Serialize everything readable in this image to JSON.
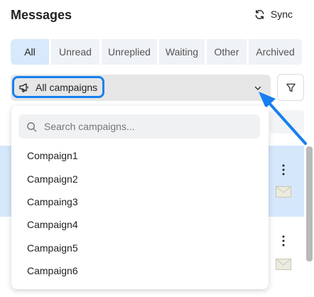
{
  "header": {
    "title": "Messages",
    "sync_label": "Sync",
    "sync_icon": "refresh-icon"
  },
  "tabs": [
    {
      "label": "All",
      "active": true
    },
    {
      "label": "Unread"
    },
    {
      "label": "Unreplied"
    },
    {
      "label": "Waiting"
    },
    {
      "label": "Other"
    },
    {
      "label": "Archived"
    }
  ],
  "campaign_select": {
    "selected": "All campaigns",
    "icon": "megaphone-icon"
  },
  "filter_icon": "filter-icon",
  "dropdown": {
    "search_placeholder": "Search campaigns...",
    "options": [
      "Compaign1",
      "Campaign2",
      "Campaing3",
      "Campaign4",
      "Campaign5",
      "Campaign6"
    ]
  },
  "colors": {
    "accent": "#1680f0",
    "active_tab": "#d8e9fb",
    "selected_row": "#d5e8fb"
  }
}
